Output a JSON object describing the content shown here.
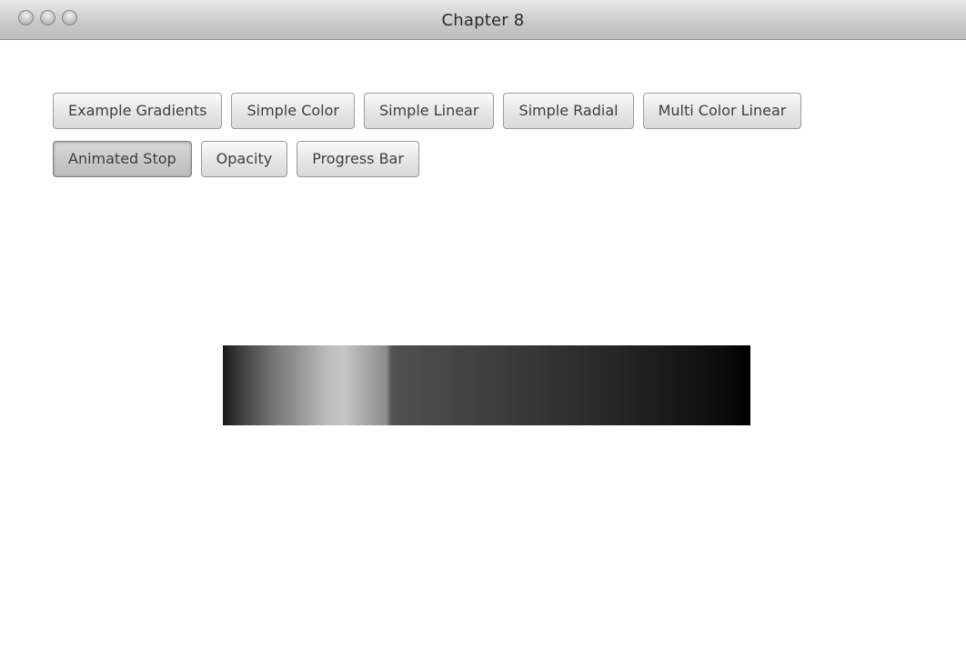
{
  "window": {
    "title": "Chapter 8"
  },
  "toolbar": {
    "row1": [
      {
        "label": "Example Gradients"
      },
      {
        "label": "Simple Color"
      },
      {
        "label": "Simple Linear"
      },
      {
        "label": "Simple Radial"
      },
      {
        "label": "Multi Color Linear"
      }
    ],
    "row2": [
      {
        "label": "Animated Stop",
        "selected": true
      },
      {
        "label": "Opacity"
      },
      {
        "label": "Progress Bar"
      }
    ]
  },
  "canvas": {
    "gradient_colors": [
      "#1a1a1a",
      "#c6c6c6",
      "#3a3a3a",
      "#000000"
    ]
  }
}
